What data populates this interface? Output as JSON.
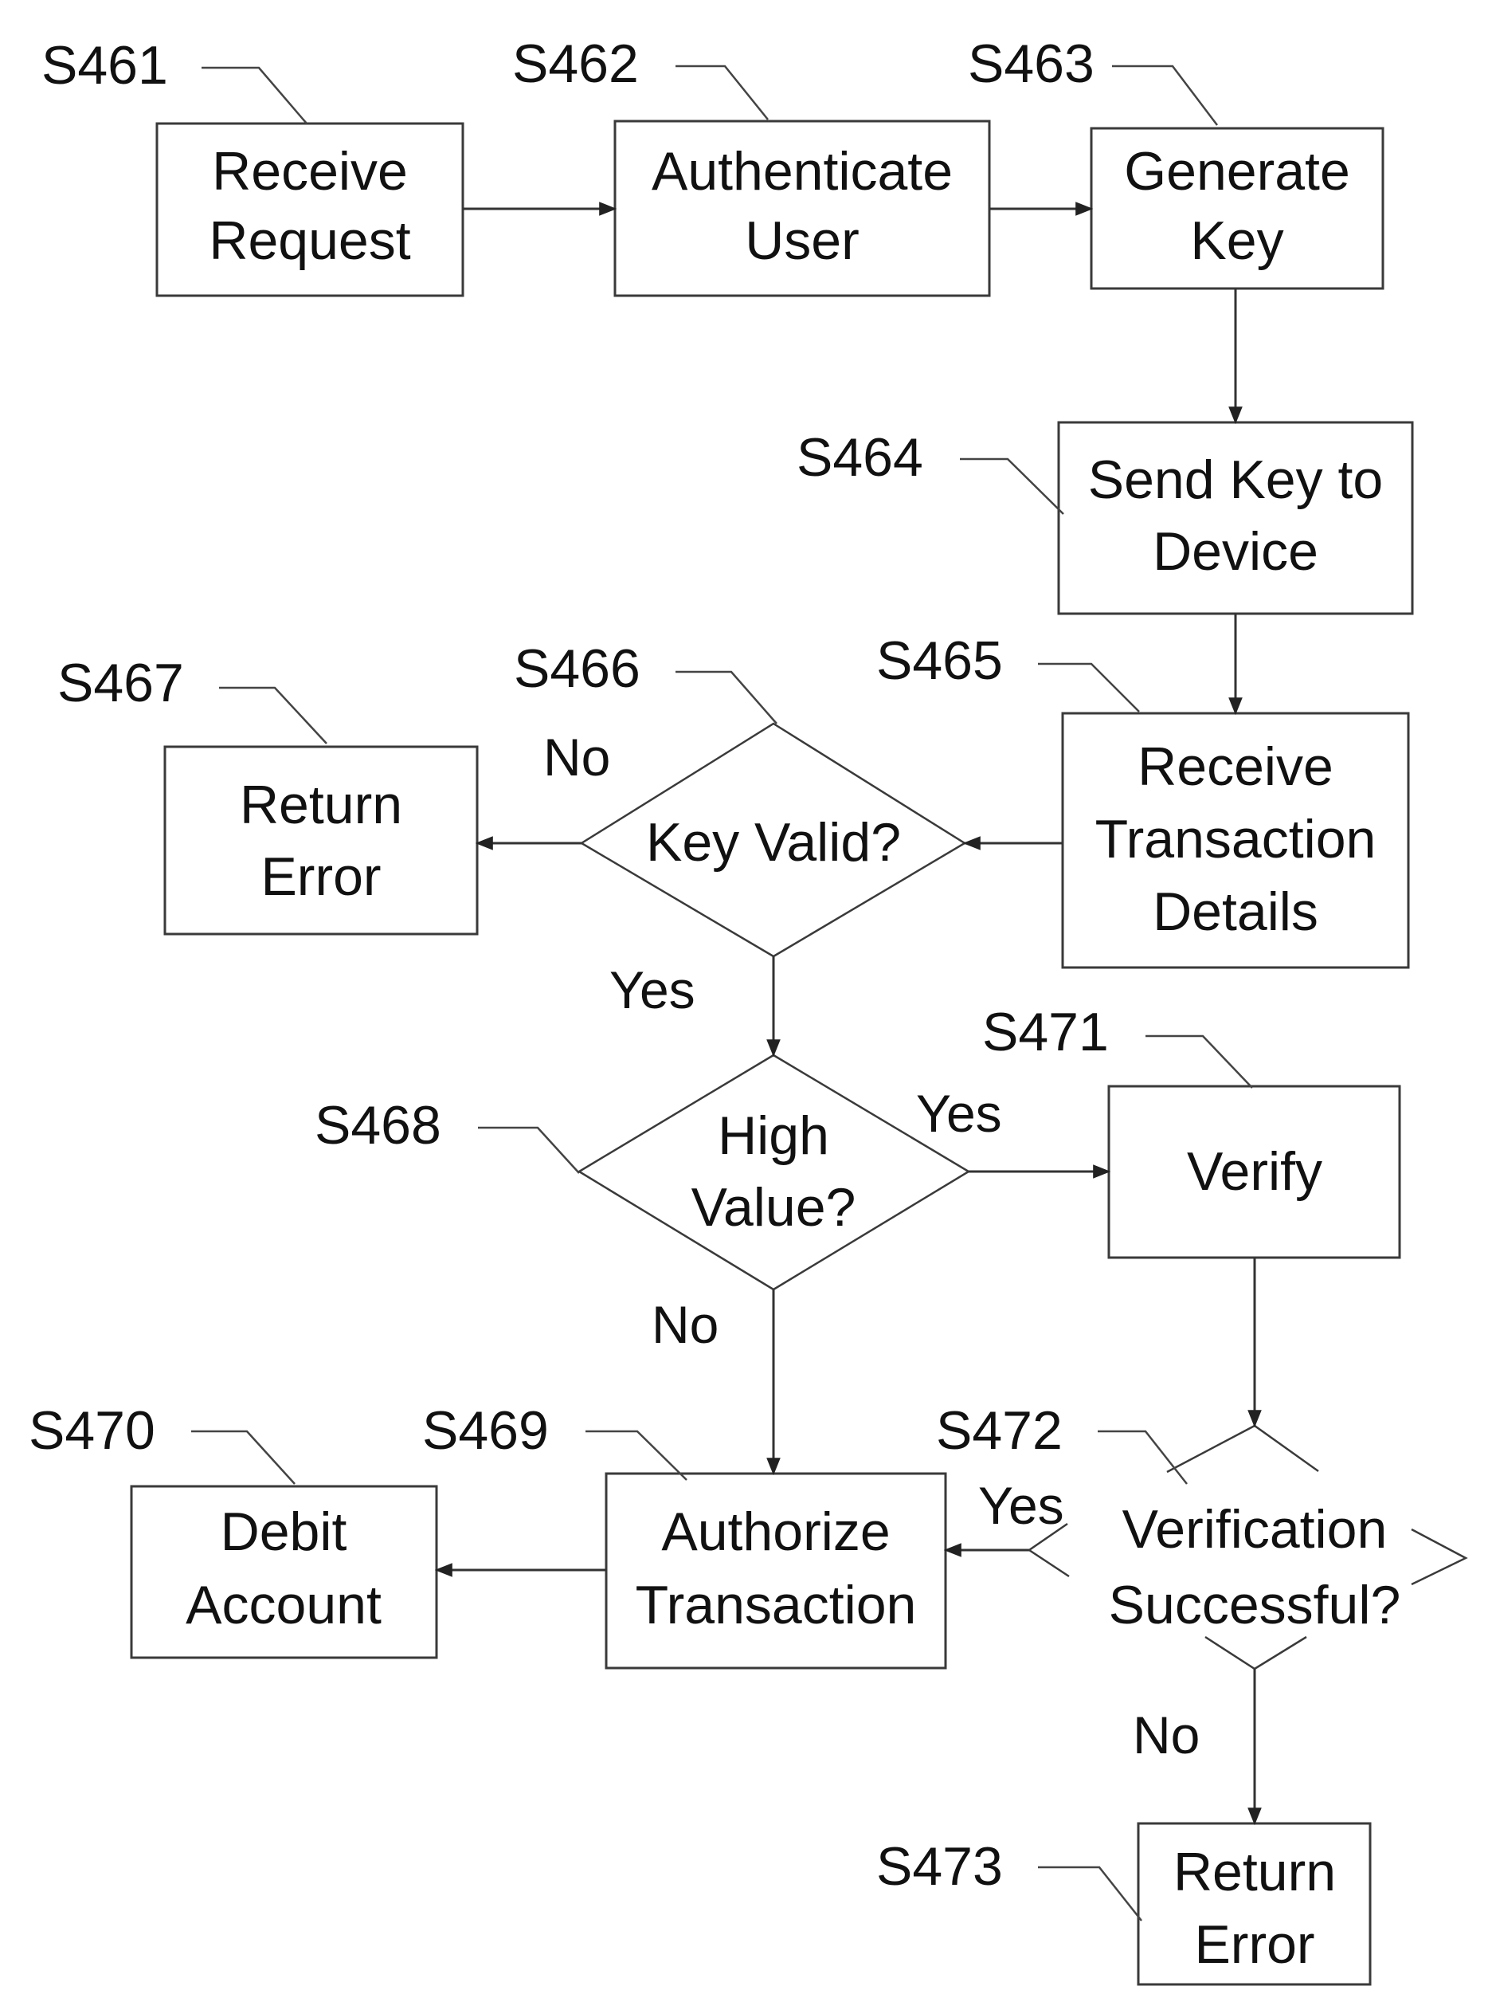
{
  "steps": {
    "s461": {
      "ref": "S461",
      "line1": "Receive",
      "line2": "Request"
    },
    "s462": {
      "ref": "S462",
      "line1": "Authenticate",
      "line2": "User"
    },
    "s463": {
      "ref": "S463",
      "line1": "Generate",
      "line2": "Key"
    },
    "s464": {
      "ref": "S464",
      "line1": "Send Key to",
      "line2": "Device"
    },
    "s465": {
      "ref": "S465",
      "line1": "Receive",
      "line2": "Transaction",
      "line3": "Details"
    },
    "s466": {
      "ref": "S466",
      "line1": "Key Valid?"
    },
    "s467": {
      "ref": "S467",
      "line1": "Return",
      "line2": "Error"
    },
    "s468": {
      "ref": "S468",
      "line1": "High",
      "line2": "Value?"
    },
    "s469": {
      "ref": "S469",
      "line1": "Authorize",
      "line2": "Transaction"
    },
    "s470": {
      "ref": "S470",
      "line1": "Debit",
      "line2": "Account"
    },
    "s471": {
      "ref": "S471",
      "line1": "Verify"
    },
    "s472": {
      "ref": "S472",
      "line1": "Verification",
      "line2": "Successful?"
    },
    "s473": {
      "ref": "S473",
      "line1": "Return",
      "line2": "Error"
    }
  },
  "conditions": {
    "s466_no": "No",
    "s466_yes": "Yes",
    "s468_yes": "Yes",
    "s468_no": "No",
    "s472_yes": "Yes",
    "s472_no": "No"
  },
  "colors": {
    "line": "#333333",
    "text": "#111111",
    "background": "#ffffff"
  }
}
